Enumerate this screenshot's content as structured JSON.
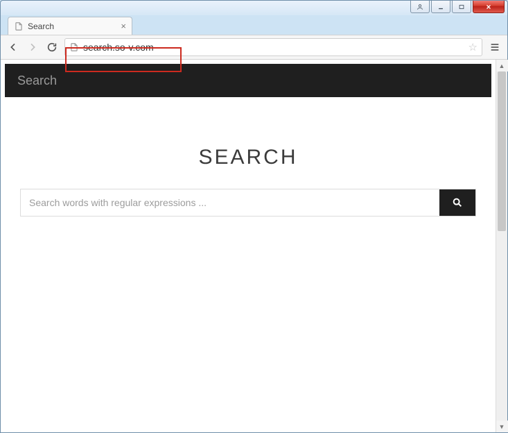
{
  "window": {
    "tab_title": "Search",
    "url": "search.so-v.com"
  },
  "site": {
    "header_brand": "Search",
    "search_heading": "SEARCH",
    "search_placeholder": "Search words with regular expressions ..."
  }
}
